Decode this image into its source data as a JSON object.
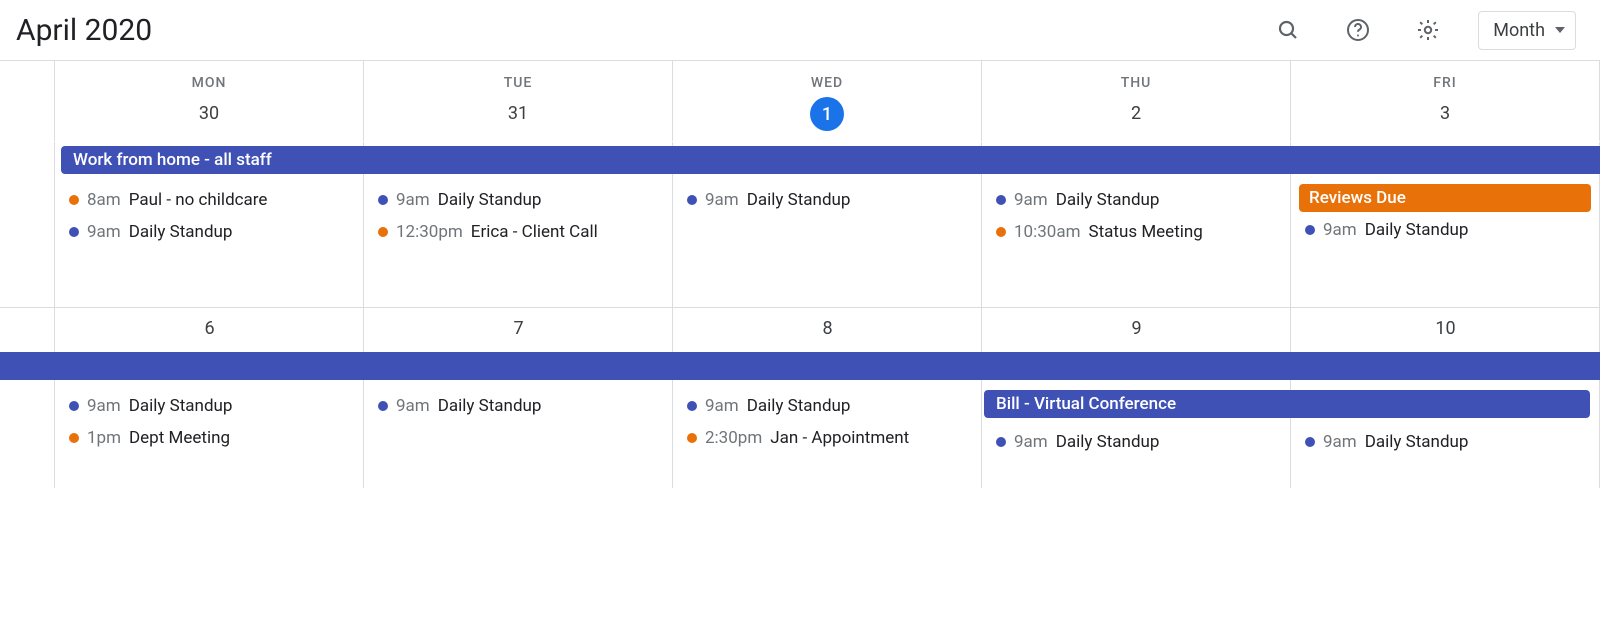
{
  "header": {
    "title": "April 2020",
    "view_label": "Month"
  },
  "colors": {
    "blue": "#3f51b5",
    "orange": "#e8710a",
    "today_blue": "#1a73e8"
  },
  "dow": [
    "MON",
    "TUE",
    "WED",
    "THU",
    "FRI"
  ],
  "weeks": [
    {
      "days": [
        {
          "num": "30",
          "today": false
        },
        {
          "num": "31",
          "today": false
        },
        {
          "num": "1",
          "today": true
        },
        {
          "num": "2",
          "today": false
        },
        {
          "num": "3",
          "today": false
        }
      ],
      "spans": [
        {
          "label": "Work from home - all staff",
          "start": 0,
          "end": 5,
          "color": "blue",
          "left_rounded": true,
          "right_rounded": false
        }
      ],
      "cells": [
        [
          {
            "dot": "orange",
            "time": "8am",
            "title": "Paul - no childcare"
          },
          {
            "dot": "blue",
            "time": "9am",
            "title": "Daily Standup"
          }
        ],
        [
          {
            "dot": "blue",
            "time": "9am",
            "title": "Daily Standup"
          },
          {
            "dot": "orange",
            "time": "12:30pm",
            "title": "Erica - Client Call"
          }
        ],
        [
          {
            "dot": "blue",
            "time": "9am",
            "title": "Daily Standup"
          }
        ],
        [
          {
            "dot": "blue",
            "time": "9am",
            "title": "Daily Standup"
          },
          {
            "dot": "orange",
            "time": "10:30am",
            "title": "Status Meeting"
          }
        ],
        [
          {
            "chip": true,
            "color": "orange",
            "title": "Reviews Due"
          },
          {
            "dot": "blue",
            "time": "9am",
            "title": "Daily Standup"
          }
        ]
      ]
    },
    {
      "days": [
        {
          "num": "6",
          "today": false
        },
        {
          "num": "7",
          "today": false
        },
        {
          "num": "8",
          "today": false
        },
        {
          "num": "9",
          "today": false
        },
        {
          "num": "10",
          "today": false
        }
      ],
      "spans": [
        {
          "label": "",
          "start": -1,
          "end": 5,
          "color": "blue",
          "left_rounded": false,
          "right_rounded": false,
          "row": 0
        },
        {
          "label": "Bill - Virtual Conference",
          "start": 3,
          "end": 5,
          "color": "blue",
          "left_rounded": true,
          "right_rounded": true,
          "row": 1
        }
      ],
      "cells": [
        [
          {
            "dot": "blue",
            "time": "9am",
            "title": "Daily Standup"
          },
          {
            "dot": "orange",
            "time": "1pm",
            "title": "Dept Meeting"
          }
        ],
        [
          {
            "dot": "blue",
            "time": "9am",
            "title": "Daily Standup"
          }
        ],
        [
          {
            "dot": "blue",
            "time": "9am",
            "title": "Daily Standup"
          },
          {
            "dot": "orange",
            "time": "2:30pm",
            "title": "Jan - Appointment"
          }
        ],
        [
          {
            "dot": "blue",
            "time": "9am",
            "title": "Daily Standup"
          }
        ],
        [
          {
            "dot": "blue",
            "time": "9am",
            "title": "Daily Standup"
          }
        ]
      ]
    }
  ]
}
